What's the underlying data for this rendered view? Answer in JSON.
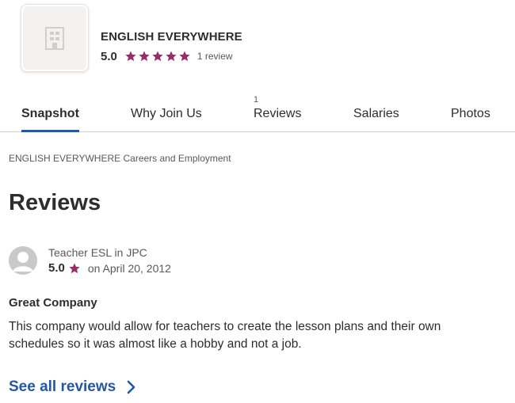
{
  "company": {
    "name": "ENGLISH EVERYWHERE",
    "rating": "5.0",
    "stars": 5,
    "review_count_label": "1 review",
    "logo_icon": "building-icon"
  },
  "tabs": [
    {
      "label": "Snapshot",
      "count": "",
      "active": true
    },
    {
      "label": "Why Join Us",
      "count": "",
      "active": false
    },
    {
      "label": "Reviews",
      "count": "1",
      "active": false
    },
    {
      "label": "Salaries",
      "count": "",
      "active": false
    },
    {
      "label": "Photos",
      "count": "",
      "active": false
    }
  ],
  "breadcrumb": "ENGLISH EVERYWHERE Careers and Employment",
  "section_title": "Reviews",
  "review": {
    "reviewer": "Teacher ESL in JPC",
    "rating": "5.0",
    "date": "on April 20, 2012",
    "title": "Great Company",
    "body": "This company would allow for teachers to create the lesson plans and their own schedules so it was almost like a hobby and not a job."
  },
  "see_all": {
    "label": "See all reviews",
    "icon": "chevron-right-icon"
  },
  "colors": {
    "star": "#9d2b6b",
    "link": "#2557a7",
    "tab_underline": "#2557a7",
    "text": "#2d2d2d",
    "muted": "#595959"
  }
}
